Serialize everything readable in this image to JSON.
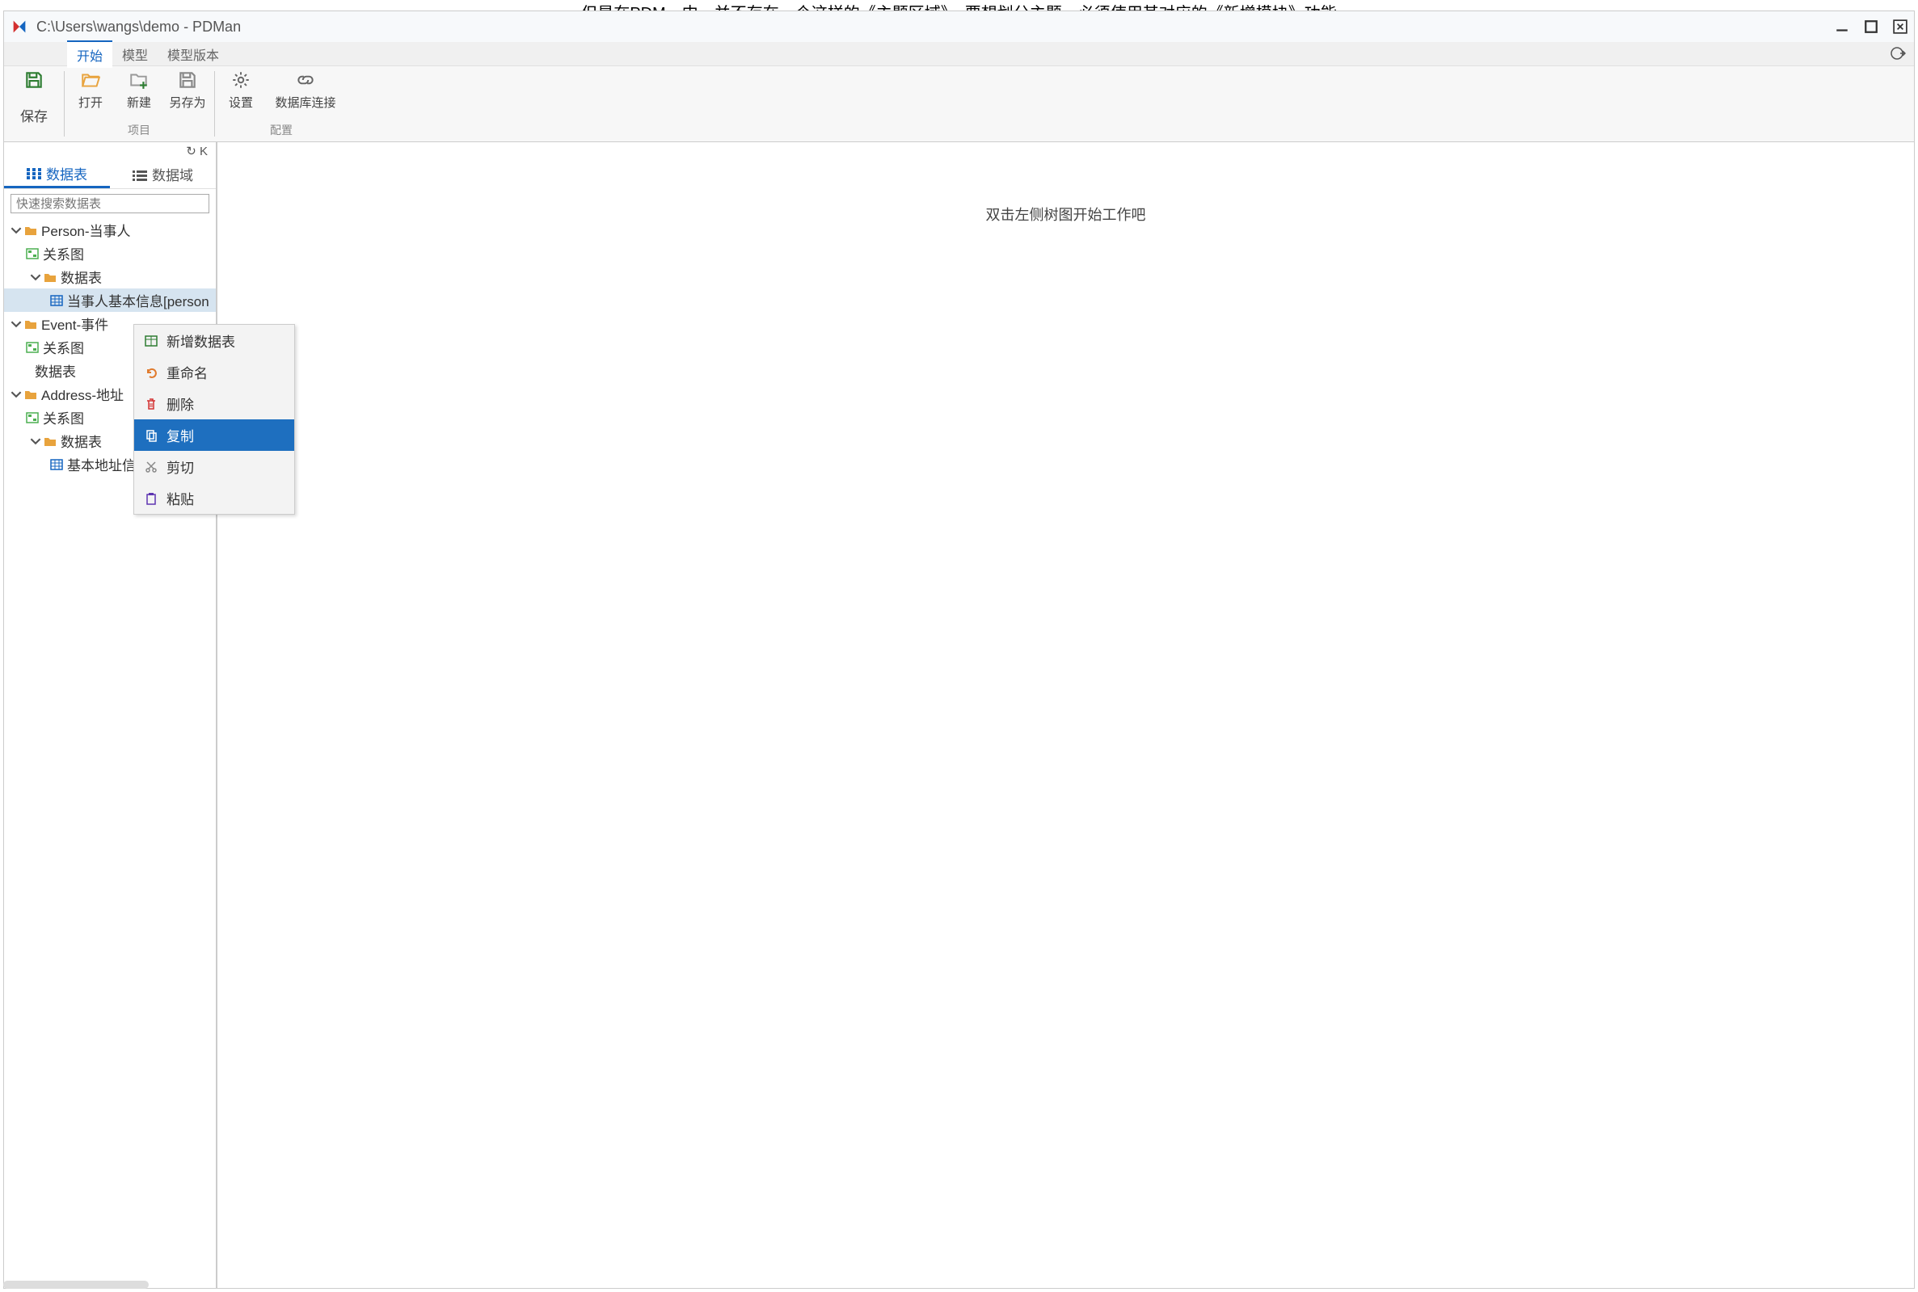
{
  "outer_text": "但是在PDM…中…并不存在一个这样的《主题区域》，要想划分主题…必须使用其对应的《新增模块》功能",
  "title": "C:\\Users\\wangs\\demo - PDMan",
  "menu_tabs": {
    "start": "开始",
    "model": "模型",
    "model_version": "模型版本"
  },
  "toolbar": {
    "save": "保存",
    "open": "打开",
    "new": "新建",
    "save_as": "另存为",
    "settings": "设置",
    "db_connect": "数据库连接",
    "group_project": "项目",
    "group_config": "配置"
  },
  "sidebar": {
    "tabs": {
      "datatable": "数据表",
      "domain": "数据域"
    },
    "search_placeholder": "快速搜索数据表",
    "top_icons": "↻ K"
  },
  "tree": {
    "person_folder": "Person-当事人",
    "relationship": "关系图",
    "datatable_folder": "数据表",
    "person_base": "当事人基本信息[person",
    "event_folder": "Event-事件",
    "address_folder": "Address-地址",
    "address_base": "基本地址信"
  },
  "context_menu": {
    "new_table": "新增数据表",
    "rename": "重命名",
    "delete": "删除",
    "copy": "复制",
    "cut": "剪切",
    "paste": "粘贴"
  },
  "main_placeholder": "双击左侧树图开始工作吧"
}
